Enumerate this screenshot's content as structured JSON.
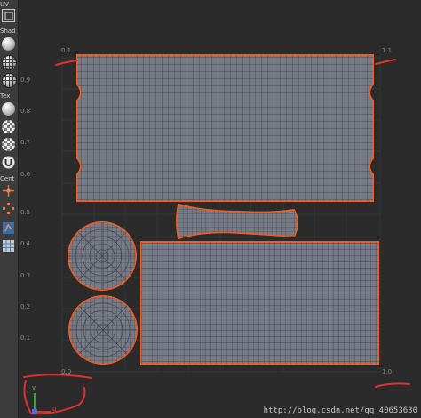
{
  "toolbar": {
    "uv_label": "UV",
    "shading_label": "Shad",
    "texture_label": "Tex",
    "centering_label": "Cent",
    "items": [
      {
        "icon": "select-tool-icon"
      },
      {
        "icon": "shaded-sphere-icon"
      },
      {
        "icon": "wireframe-sphere-icon"
      },
      {
        "icon": "textured-sphere-icon"
      },
      {
        "icon": "plain-sphere-icon"
      },
      {
        "icon": "checker-sphere-icon"
      },
      {
        "icon": "checker-sphere-icon"
      },
      {
        "icon": "magnet-icon"
      },
      {
        "icon": "center-pivot-icon"
      },
      {
        "icon": "center-pivot-icon"
      },
      {
        "icon": "uv-shell-icon"
      },
      {
        "icon": "grid-icon"
      }
    ]
  },
  "grid": {
    "top_left": "0.1",
    "top_right": "1.1",
    "bottom_left": "0.0",
    "bottom_right": "1.0",
    "v_labels": [
      "0.9",
      "0.8",
      "0.7",
      "0.6",
      "0.5",
      "0.4",
      "0.3",
      "0.2",
      "0.1"
    ]
  },
  "axis": {
    "u": "u",
    "v": "v"
  },
  "watermark": "http://blog.csdn.net/qq_40653630",
  "colors": {
    "background": "#2b2b2b",
    "shell_fill": "#757a86",
    "shell_outline": "#e8602a",
    "annotation": "#e0312d",
    "grid": "#3f3f3f"
  }
}
